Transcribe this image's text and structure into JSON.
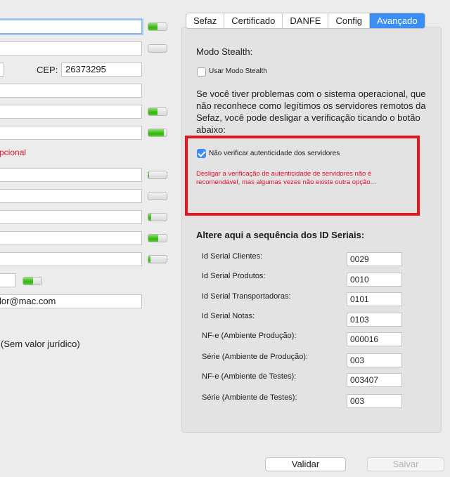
{
  "left_form": {
    "cep_label": "CEP:",
    "cep_value": "26373295",
    "optional_note": "pcional",
    "email_value": "lor@mac.com",
    "no_legal_value": "(Sem valor jurídico)",
    "status_bars": [
      0.5,
      0,
      0.5,
      0.85,
      0.05,
      0,
      0.15,
      0.55,
      0.1,
      0.55
    ]
  },
  "tabs": [
    {
      "label": "Sefaz",
      "selected": false
    },
    {
      "label": "Certificado",
      "selected": false
    },
    {
      "label": "DANFE",
      "selected": false
    },
    {
      "label": "Config",
      "selected": false
    },
    {
      "label": "Avançado",
      "selected": true
    }
  ],
  "stealth": {
    "title": "Modo Stealth:",
    "checkbox_label": "Usar Modo Stealth",
    "checked": false
  },
  "problem_text": "Se você tiver problemas com o sistema operacional, que não reconhece como legítimos os servidores remotos da Sefaz, você pode desligar a verificação ticando o botão abaixo:",
  "verify": {
    "checkbox_label": "Não verificar autenticidade dos servidores",
    "checked": true,
    "warning": "Desligar a verificação de autenticidade de servidores não é recomendável, mas algumas vezes não existe outra opção..."
  },
  "serials": {
    "heading": "Altere aqui a sequência dos ID Seriais:",
    "rows": [
      {
        "label": "Id Serial Clientes:",
        "value": "0029"
      },
      {
        "label": "Id Serial Produtos:",
        "value": "0010"
      },
      {
        "label": "Id Serial Transportadoras:",
        "value": "0101"
      },
      {
        "label": "Id Serial Notas:",
        "value": "0103"
      },
      {
        "label": "NF-e (Ambiente Produção):",
        "value": "000016"
      },
      {
        "label": "Série (Ambiente de Produção):",
        "value": "003"
      },
      {
        "label": "NF-e (Ambiente de Testes):",
        "value": "003407"
      },
      {
        "label": "Série (Ambiente de Testes):",
        "value": "003"
      }
    ]
  },
  "buttons": {
    "validate": "Validar",
    "save": "Salvar"
  },
  "colors": {
    "accent": "#3b8ef3",
    "warning_red": "#e0102a",
    "highlight_box": "#e8161b"
  }
}
